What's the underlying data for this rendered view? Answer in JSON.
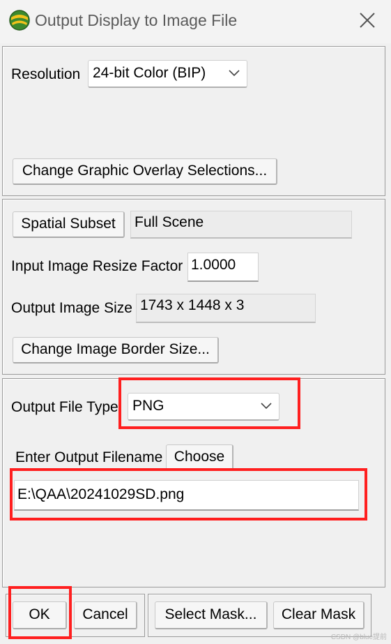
{
  "window": {
    "title": "Output Display to Image File",
    "app_icon": "envi-globe-icon",
    "close_icon": "close-icon"
  },
  "resolution": {
    "label": "Resolution",
    "value": "24-bit Color (BIP)"
  },
  "graphic_overlay_button": "Change Graphic Overlay Selections...",
  "spatial": {
    "subset_button": "Spatial Subset",
    "subset_value": "Full Scene",
    "resize_label": "Input Image Resize Factor",
    "resize_value": "1.0000",
    "output_size_label": "Output Image Size",
    "output_size_value": "1743 x 1448 x 3",
    "border_button": "Change Image Border Size..."
  },
  "output": {
    "file_type_label": "Output File Type",
    "file_type_value": "PNG",
    "filename_label": "Enter Output Filename",
    "choose_button": "Choose",
    "filename_value": "E:\\QAA\\20241029SD.png"
  },
  "footer": {
    "ok": "OK",
    "cancel": "Cancel",
    "select_mask": "Select Mask...",
    "clear_mask": "Clear Mask"
  },
  "watermark": "CSDN @blue提前",
  "colors": {
    "highlight": "#ff1f1f",
    "background": "#f0f0f0"
  }
}
